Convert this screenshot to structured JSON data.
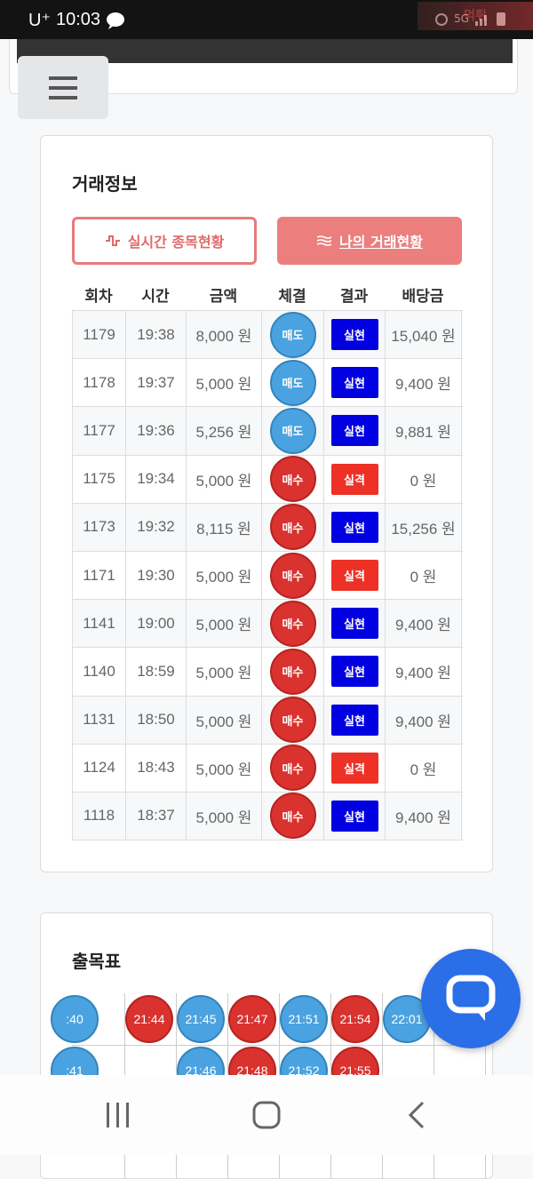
{
  "status_bar": {
    "carrier": "U⁺",
    "time": "10:03",
    "network": "5G",
    "logo_text": "먹튀"
  },
  "trade_card": {
    "title": "거래정보",
    "live_button": "실시간 종목현황",
    "mine_button": "나의 거래현황",
    "columns": [
      "회차",
      "시간",
      "금액",
      "체결",
      "결과",
      "배당금"
    ],
    "rows": [
      {
        "round": "1179",
        "time": "19:38",
        "amount": "8,000 원",
        "side": "매도",
        "result": "실현",
        "payout": "15,040 원"
      },
      {
        "round": "1178",
        "time": "19:37",
        "amount": "5,000 원",
        "side": "매도",
        "result": "실현",
        "payout": "9,400 원"
      },
      {
        "round": "1177",
        "time": "19:36",
        "amount": "5,256 원",
        "side": "매도",
        "result": "실현",
        "payout": "9,881 원"
      },
      {
        "round": "1175",
        "time": "19:34",
        "amount": "5,000 원",
        "side": "매수",
        "result": "실격",
        "payout": "0 원"
      },
      {
        "round": "1173",
        "time": "19:32",
        "amount": "8,115 원",
        "side": "매수",
        "result": "실현",
        "payout": "15,256 원"
      },
      {
        "round": "1171",
        "time": "19:30",
        "amount": "5,000 원",
        "side": "매수",
        "result": "실격",
        "payout": "0 원"
      },
      {
        "round": "1141",
        "time": "19:00",
        "amount": "5,000 원",
        "side": "매수",
        "result": "실현",
        "payout": "9,400 원"
      },
      {
        "round": "1140",
        "time": "18:59",
        "amount": "5,000 원",
        "side": "매수",
        "result": "실현",
        "payout": "9,400 원"
      },
      {
        "round": "1131",
        "time": "18:50",
        "amount": "5,000 원",
        "side": "매수",
        "result": "실현",
        "payout": "9,400 원"
      },
      {
        "round": "1124",
        "time": "18:43",
        "amount": "5,000 원",
        "side": "매수",
        "result": "실격",
        "payout": "0 원"
      },
      {
        "round": "1118",
        "time": "18:37",
        "amount": "5,000 원",
        "side": "매수",
        "result": "실현",
        "payout": "9,400 원"
      }
    ]
  },
  "chart_card": {
    "title": "출목표",
    "columns": [
      {
        "top": {
          "label": ":40",
          "color": "blue"
        },
        "bottom": {
          "label": ":41",
          "color": "blue"
        }
      },
      {
        "top": {
          "label": "21:44",
          "color": "red"
        },
        "bottom": null
      },
      {
        "top": {
          "label": "21:45",
          "color": "blue"
        },
        "bottom": {
          "label": "21:46",
          "color": "blue"
        }
      },
      {
        "top": {
          "label": "21:47",
          "color": "red"
        },
        "bottom": {
          "label": "21:48",
          "color": "red"
        }
      },
      {
        "top": {
          "label": "21:51",
          "color": "blue"
        },
        "bottom": {
          "label": "21:52",
          "color": "blue"
        }
      },
      {
        "top": {
          "label": "21:54",
          "color": "red"
        },
        "bottom": {
          "label": "21:55",
          "color": "red"
        }
      },
      {
        "top": {
          "label": "22:01",
          "color": "blue"
        },
        "bottom": null
      },
      {
        "top": {
          "label": "2",
          "color": "red"
        },
        "bottom": null
      }
    ]
  },
  "colors": {
    "sell": "#4aa3e0",
    "buy": "#d9322f",
    "hit": "#0000e0",
    "miss": "#ed3126",
    "accent": "#ec7e7e",
    "fab": "#2a6ee8"
  },
  "icons": {
    "menu": "hamburger-icon",
    "live": "pulse-icon",
    "mine": "waves-icon",
    "chat": "chat-bubble-icon",
    "nav_recent": "recent-apps-icon",
    "nav_home": "home-icon",
    "nav_back": "back-icon"
  }
}
